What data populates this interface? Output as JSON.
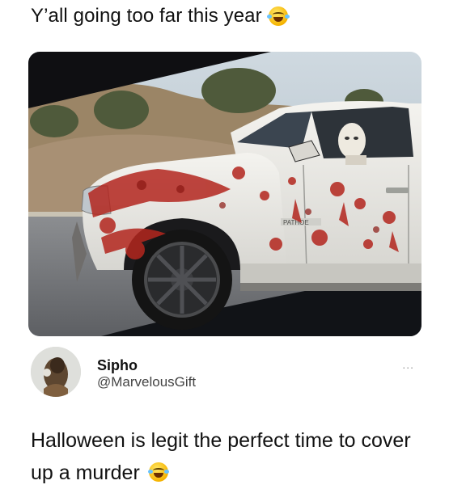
{
  "post": {
    "caption": "Y’all going too far this year",
    "caption_emoji": "rolling-on-floor-laughing-emoji"
  },
  "tweet": {
    "author_name": "Sipho",
    "author_handle": "@MarvelousGift",
    "more_label": "...",
    "text": "Halloween is legit the perfect time to cover up a murder",
    "text_emoji": "face-with-tears-of-joy-emoji"
  },
  "photo": {
    "badge_text": "PATHOE",
    "colors": {
      "truck": "#ecebe6",
      "blood": "#b3261e",
      "sky": "#b8c9d6",
      "hill": "#9b8566"
    }
  }
}
